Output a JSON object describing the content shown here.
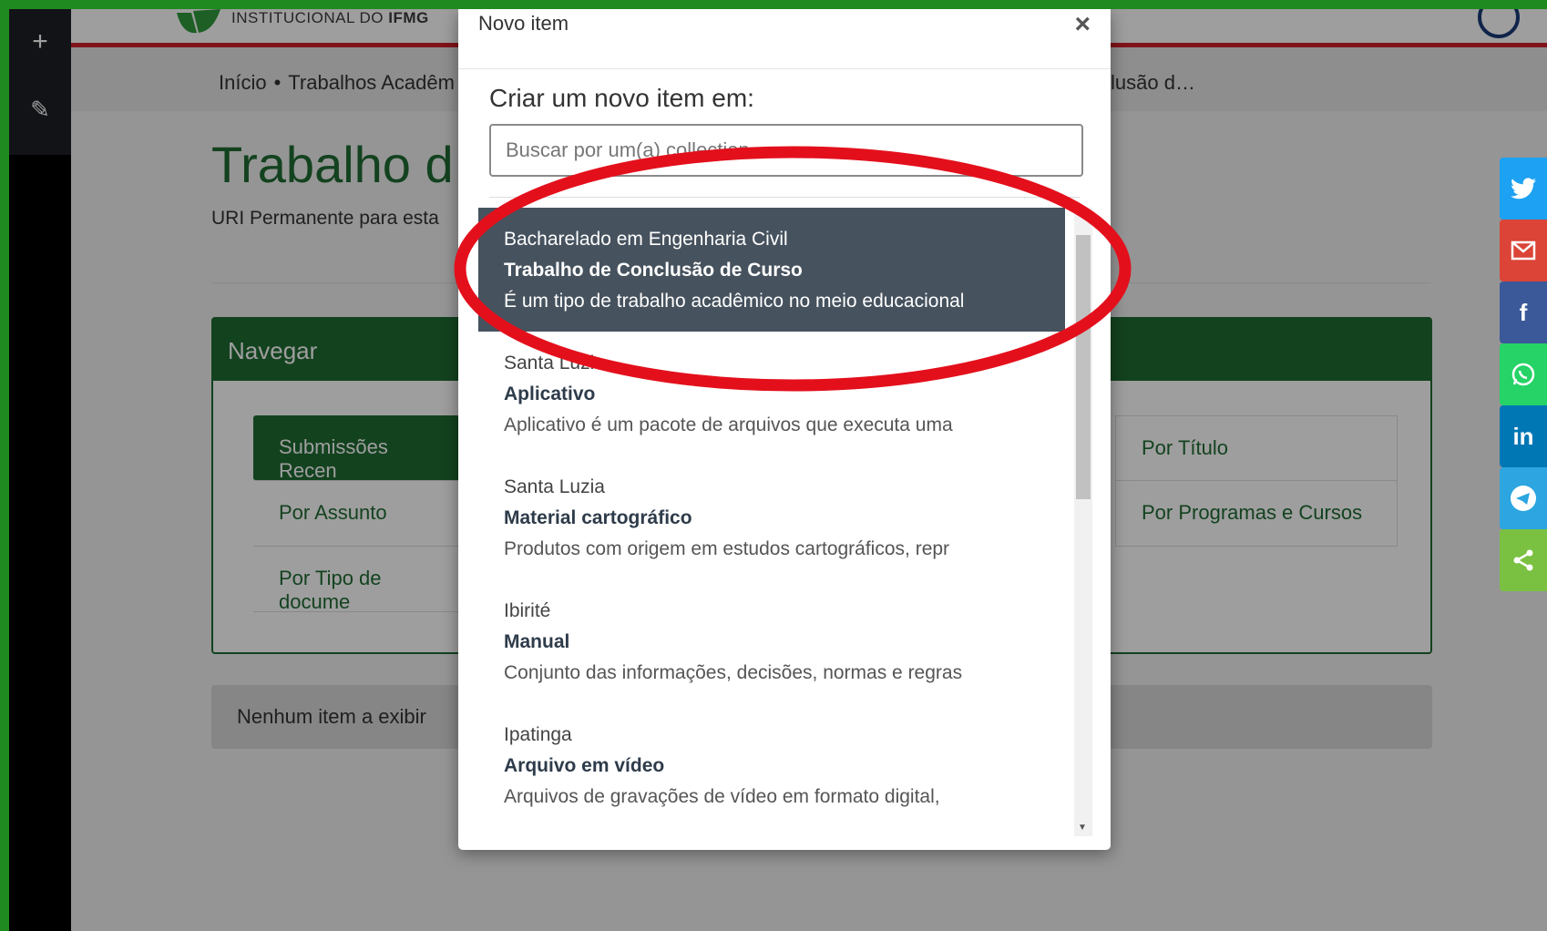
{
  "header": {
    "logo_text_light": "INSTITUCIONAL DO ",
    "logo_text_bold": "IFMG"
  },
  "breadcrumb": {
    "items": [
      "Início",
      "Trabalhos Acadêm"
    ],
    "separator": "•",
    "tail": "clusão d…"
  },
  "page": {
    "title": "Trabalho d",
    "uri_label": "URI Permanente para esta"
  },
  "navigate": {
    "title": "Navegar",
    "items": {
      "recent": "Submissões Recen",
      "assunto": "Por Assunto",
      "tipo": "Por Tipo de docume",
      "titulo": "Por Título",
      "programas": "Por Programas e Cursos"
    }
  },
  "empty": {
    "text": "Nenhum item a exibir"
  },
  "admin_sidebar": {
    "add_icon": "+",
    "edit_icon": "✎"
  },
  "share": {
    "icons": [
      "twitter-icon",
      "email-icon",
      "facebook-icon",
      "whatsapp-icon",
      "linkedin-icon",
      "telegram-icon",
      "share-icon"
    ],
    "colors": [
      "#1da1f2",
      "#db4437",
      "#3b5998",
      "#25d366",
      "#0077b5",
      "#2ca5e0",
      "#7ac142"
    ],
    "facebook_glyph": "f",
    "linkedin_glyph": "in"
  },
  "modal": {
    "title": "Novo item",
    "close": "×",
    "prompt": "Criar um novo item em:",
    "search_placeholder": "Buscar por um(a) collection",
    "items": [
      {
        "community": "Bacharelado em Engenharia Civil",
        "type": "Trabalho de Conclusão de Curso",
        "description": "É um tipo de trabalho acadêmico no meio educacional"
      },
      {
        "community": "Santa Luzia",
        "type": "Aplicativo",
        "description": "Aplicativo é um pacote de arquivos que executa uma"
      },
      {
        "community": "Santa Luzia",
        "type": "Material cartográfico",
        "description": "Produtos com origem em estudos cartográficos, repr"
      },
      {
        "community": "Ibirité",
        "type": "Manual",
        "description": "Conjunto das informações, decisões, normas e regras"
      },
      {
        "community": "Ipatinga",
        "type": "Arquivo em vídeo",
        "description": "Arquivos de gravações de vídeo em formato digital,"
      }
    ]
  },
  "colors": {
    "frame_green": "#1f8a1f",
    "brand_green": "#1f6b33",
    "header_red": "#d0202a",
    "selected_item": "#46525e",
    "annotation_red": "#e3101c"
  }
}
